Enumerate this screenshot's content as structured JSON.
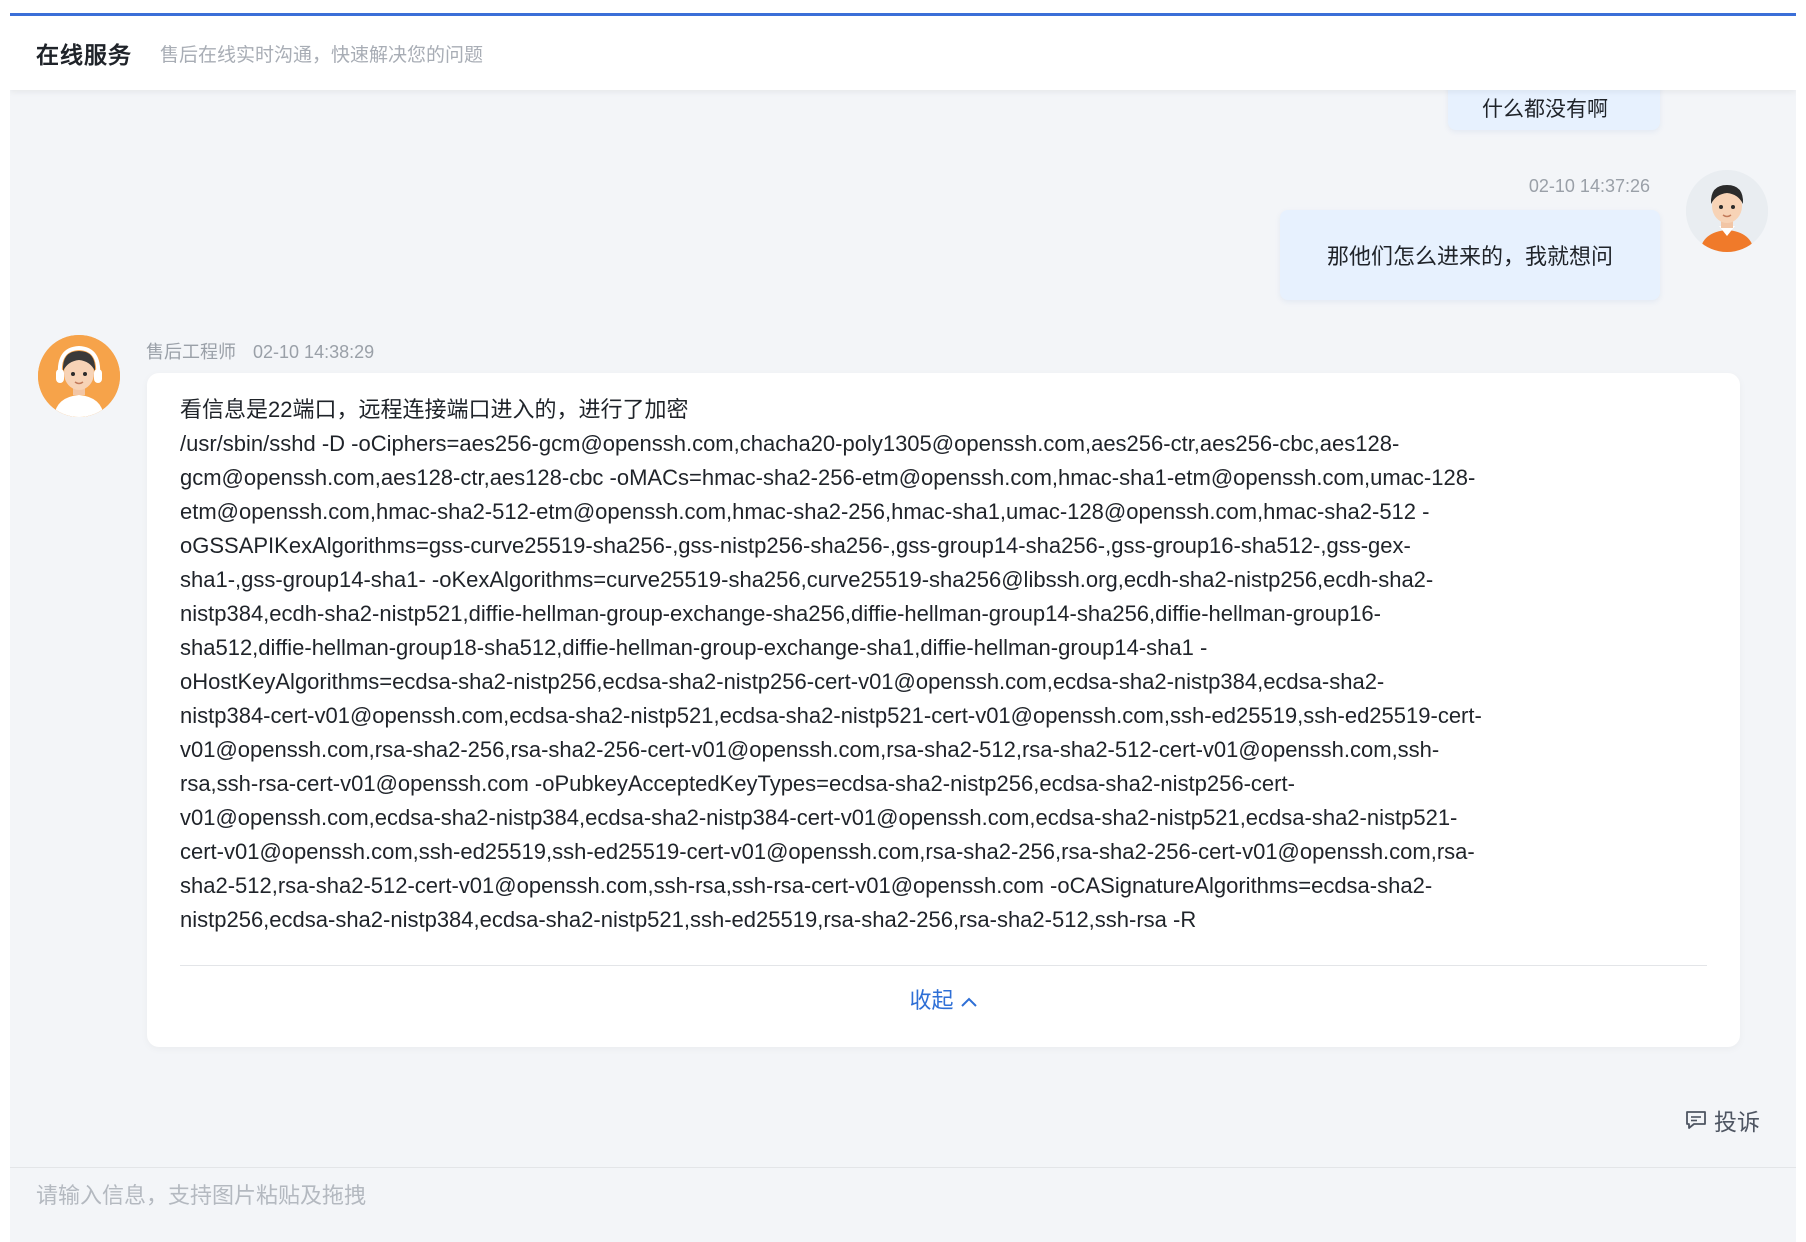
{
  "header": {
    "title": "在线服务",
    "subtitle": "售后在线实时沟通，快速解决您的问题"
  },
  "messages": {
    "prev_user_text": "什么都没有啊",
    "user": {
      "time": "02-10 14:37:26",
      "text": "那他们怎么进来的，我就想问"
    },
    "engineer": {
      "name": "售后工程师",
      "time": "02-10 14:38:29",
      "lines": [
        "看信息是22端口，远程连接端口进入的，进行了加密",
        "/usr/sbin/sshd -D -oCiphers=aes256-gcm@openssh.com,chacha20-poly1305@openssh.com,aes256-ctr,aes256-cbc,aes128-",
        "gcm@openssh.com,aes128-ctr,aes128-cbc -oMACs=hmac-sha2-256-etm@openssh.com,hmac-sha1-etm@openssh.com,umac-128-",
        "etm@openssh.com,hmac-sha2-512-etm@openssh.com,hmac-sha2-256,hmac-sha1,umac-128@openssh.com,hmac-sha2-512 -",
        "oGSSAPIKexAlgorithms=gss-curve25519-sha256-,gss-nistp256-sha256-,gss-group14-sha256-,gss-group16-sha512-,gss-gex-",
        "sha1-,gss-group14-sha1- -oKexAlgorithms=curve25519-sha256,curve25519-sha256@libssh.org,ecdh-sha2-nistp256,ecdh-sha2-",
        "nistp384,ecdh-sha2-nistp521,diffie-hellman-group-exchange-sha256,diffie-hellman-group14-sha256,diffie-hellman-group16-",
        "sha512,diffie-hellman-group18-sha512,diffie-hellman-group-exchange-sha1,diffie-hellman-group14-sha1 -",
        "oHostKeyAlgorithms=ecdsa-sha2-nistp256,ecdsa-sha2-nistp256-cert-v01@openssh.com,ecdsa-sha2-nistp384,ecdsa-sha2-",
        "nistp384-cert-v01@openssh.com,ecdsa-sha2-nistp521,ecdsa-sha2-nistp521-cert-v01@openssh.com,ssh-ed25519,ssh-ed25519-cert-",
        "v01@openssh.com,rsa-sha2-256,rsa-sha2-256-cert-v01@openssh.com,rsa-sha2-512,rsa-sha2-512-cert-v01@openssh.com,ssh-",
        "rsa,ssh-rsa-cert-v01@openssh.com -oPubkeyAcceptedKeyTypes=ecdsa-sha2-nistp256,ecdsa-sha2-nistp256-cert-",
        "v01@openssh.com,ecdsa-sha2-nistp384,ecdsa-sha2-nistp384-cert-v01@openssh.com,ecdsa-sha2-nistp521,ecdsa-sha2-nistp521-",
        "cert-v01@openssh.com,ssh-ed25519,ssh-ed25519-cert-v01@openssh.com,rsa-sha2-256,rsa-sha2-256-cert-v01@openssh.com,rsa-",
        "sha2-512,rsa-sha2-512-cert-v01@openssh.com,ssh-rsa,ssh-rsa-cert-v01@openssh.com -oCASignatureAlgorithms=ecdsa-sha2-",
        "nistp256,ecdsa-sha2-nistp384,ecdsa-sha2-nistp521,ssh-ed25519,rsa-sha2-256,rsa-sha2-512,ssh-rsa -R"
      ],
      "collapse_label": "收起"
    }
  },
  "complaint_label": "投诉",
  "input": {
    "placeholder": "请输入信息，支持图片粘贴及拖拽",
    "value": ""
  },
  "colors": {
    "accent": "#3b6fd8",
    "link": "#2e6fd6",
    "user_bubble": "#e7f1fe",
    "background": "#f3f5f8"
  }
}
